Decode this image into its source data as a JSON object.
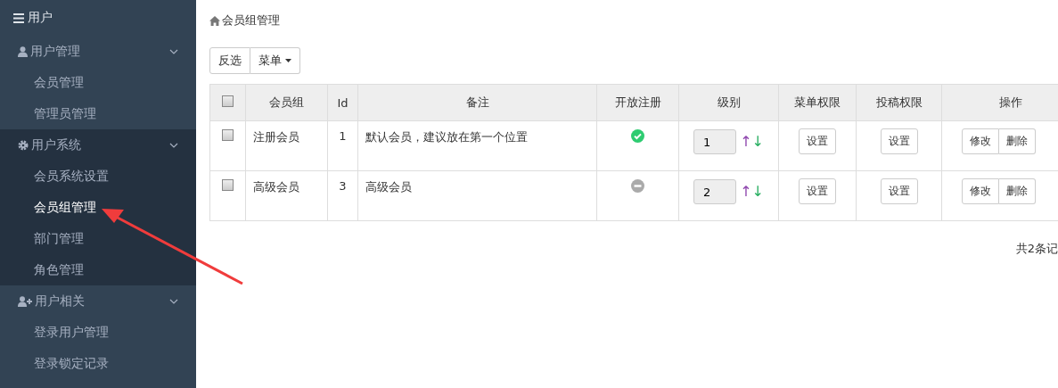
{
  "sidebar": {
    "title": "用户",
    "groups": [
      {
        "label": "用户管理",
        "kind": "user",
        "active": false,
        "expanded": true,
        "items": [
          {
            "label": "会员管理",
            "selected": false
          },
          {
            "label": "管理员管理",
            "selected": false
          }
        ]
      },
      {
        "label": "用户系统",
        "kind": "gear",
        "active": true,
        "expanded": true,
        "items": [
          {
            "label": "会员系统设置",
            "selected": false
          },
          {
            "label": "会员组管理",
            "selected": true
          },
          {
            "label": "部门管理",
            "selected": false
          },
          {
            "label": "角色管理",
            "selected": false
          }
        ]
      },
      {
        "label": "用户相关",
        "kind": "user-plus",
        "active": false,
        "expanded": true,
        "items": [
          {
            "label": "登录用户管理",
            "selected": false
          },
          {
            "label": "登录锁定记录",
            "selected": false
          }
        ]
      }
    ]
  },
  "breadcrumb": "会员组管理",
  "toolbar": {
    "invert": "反选",
    "menu": "菜单"
  },
  "table": {
    "all_checked": false,
    "columns": [
      "会员组",
      "Id",
      "备注",
      "开放注册",
      "级别",
      "菜单权限",
      "投稿权限",
      "操作"
    ],
    "rows": [
      {
        "checked": false,
        "group": "注册会员",
        "id": "1",
        "note": "默认会员，建议放在第一个位置",
        "open": true,
        "level": "1",
        "up": "↑",
        "down": "↓",
        "menu_perm": "设置",
        "post_perm": "设置",
        "edit": "修改",
        "delete": "删除"
      },
      {
        "checked": false,
        "group": "高级会员",
        "id": "3",
        "note": "高级会员",
        "open": false,
        "level": "2",
        "up": "↑",
        "down": "↓",
        "menu_perm": "设置",
        "post_perm": "设置",
        "edit": "修改",
        "delete": "删除"
      }
    ]
  },
  "footer": "共2条记"
}
